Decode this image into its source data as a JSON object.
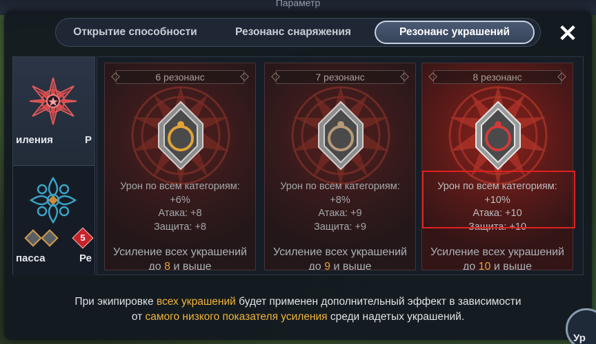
{
  "window": {
    "top_strip_text": "Параметр"
  },
  "tabs": [
    {
      "label": "Открытие способности",
      "active": false
    },
    {
      "label": "Резонанс снаряжения",
      "active": false
    },
    {
      "label": "Резонанс украшений",
      "active": true
    }
  ],
  "close_icon": "close-icon",
  "categories": [
    {
      "label_left": "иления",
      "label_right": "Р",
      "selected": true,
      "icon": "red-star-emblem-icon"
    },
    {
      "label_left": "пасса",
      "label_right": "Ре",
      "selected": false,
      "icon": "blue-cross-emblem-icon",
      "badge_count": "5"
    }
  ],
  "cards": [
    {
      "title": "6 резонанс",
      "stats": [
        "Урон по всем категориям:",
        "+6%",
        "Атака: +8",
        "Защита: +8"
      ],
      "foot_prefix": "Усиление всех украшений",
      "foot_pre_num": "до ",
      "foot_num": "8",
      "foot_post_num": " и выше"
    },
    {
      "title": "7 резонанс",
      "stats": [
        "Урон по всем категориям:",
        "+8%",
        "Атака: +9",
        "Защита: +9"
      ],
      "foot_prefix": "Усиление всех украшений",
      "foot_pre_num": "до ",
      "foot_num": "9",
      "foot_post_num": " и выше"
    },
    {
      "title": "8 резонанс",
      "stats": [
        "Урон по всем категориям:",
        "+10%",
        "Атака: +10",
        "Защита: +10"
      ],
      "foot_prefix": "Усиление всех украшений",
      "foot_pre_num": "до ",
      "foot_num": "10",
      "foot_post_num": " и выше"
    }
  ],
  "note": {
    "line1_a": "При экипировке ",
    "line1_hl": "всех украшений",
    "line1_b": " будет применен дополнительный эффект в зависимости",
    "line2_a": "от ",
    "line2_hl": "самого низкого показателя усиления",
    "line2_b": " среди надетых украшений."
  },
  "corner_button": {
    "label": "Ур"
  },
  "colors": {
    "highlight": "#f1b43a",
    "active_tab_border": "#c8d2e3",
    "selection_box": "#e02020"
  }
}
